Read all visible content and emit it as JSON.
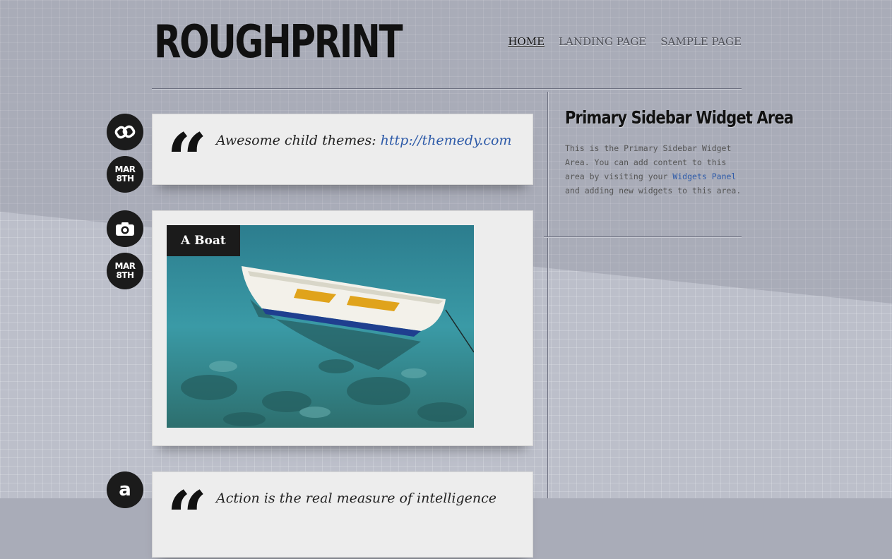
{
  "site": {
    "logo": "ROUGHPRINT"
  },
  "nav": {
    "items": [
      "HOME",
      "LANDING PAGE",
      "SAMPLE PAGE"
    ]
  },
  "posts": [
    {
      "type_icon": "link-icon",
      "date_month": "MAR",
      "date_day": "8TH",
      "quote_mark": "“",
      "quote_prefix": "Awesome child themes: ",
      "quote_link": "http://themedy.com"
    },
    {
      "type_icon": "camera-icon",
      "date_month": "MAR",
      "date_day": "8TH",
      "image_title": "A Boat"
    },
    {
      "type_icon": "quote-author-icon",
      "type_glyph": "a",
      "quote_mark": "“",
      "quote_text": "Action is the real measure of intelligence"
    }
  ],
  "sidebar": {
    "title": "Primary Sidebar Widget Area",
    "text_before": "This is the Primary Sidebar Widget Area. You can add content to this area by visiting your ",
    "link": "Widgets Panel",
    "text_after": " and adding new widgets to this area."
  },
  "colors": {
    "background": "#a9acb8",
    "card": "#ededed",
    "accent_link": "#2d5aa8",
    "dark": "#1b1b1b"
  }
}
